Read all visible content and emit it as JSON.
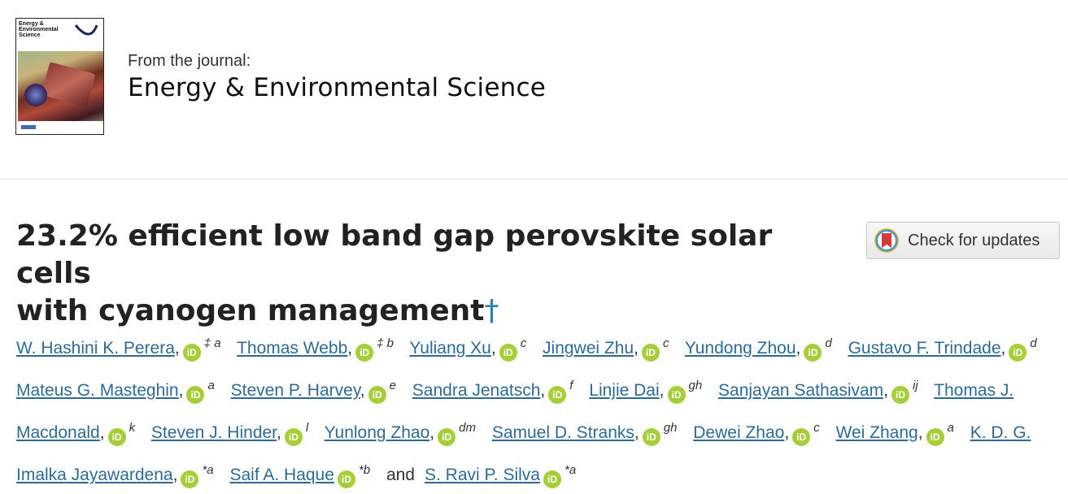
{
  "journal": {
    "from_label": "From the journal:",
    "name": "Energy & Environmental Science",
    "cover_title": "Energy & Environmental Science"
  },
  "article": {
    "title_line1": "23.2% efficient low band gap perovskite solar cells",
    "title_line2": "with cyanogen management",
    "title_dagger": "†",
    "check_updates_label": "Check for updates"
  },
  "authors": [
    {
      "name": "W. Hashini K. Perera",
      "sep": ",",
      "sup": "‡ a"
    },
    {
      "name": "Thomas Webb",
      "sep": ",",
      "sup": "‡ b"
    },
    {
      "name": "Yuliang Xu",
      "sep": ",",
      "sup": "c"
    },
    {
      "name": "Jingwei Zhu",
      "sep": ",",
      "sup": "c"
    },
    {
      "name": "Yundong Zhou",
      "sep": ",",
      "sup": "d"
    },
    {
      "name": "Gustavo F. Trindade",
      "sep": ",",
      "sup": "d"
    },
    {
      "name": "Mateus G. Masteghin",
      "sep": ",",
      "sup": "a"
    },
    {
      "name": "Steven P. Harvey",
      "sep": ",",
      "sup": "e"
    },
    {
      "name": "Sandra Jenatsch",
      "sep": ",",
      "sup": "f"
    },
    {
      "name": "Linjie Dai",
      "sep": ",",
      "sup": "gh"
    },
    {
      "name": "Sanjayan Sathasivam",
      "sep": ",",
      "sup": "ij"
    },
    {
      "name": "Thomas J. Macdonald",
      "sep": ",",
      "sup": "k"
    },
    {
      "name": "Steven J. Hinder",
      "sep": ",",
      "sup": "l"
    },
    {
      "name": "Yunlong Zhao",
      "sep": ",",
      "sup": "dm"
    },
    {
      "name": "Samuel D. Stranks",
      "sep": ",",
      "sup": "gh"
    },
    {
      "name": "Dewei Zhao",
      "sep": ",",
      "sup": "c"
    },
    {
      "name": "Wei Zhang",
      "sep": ",",
      "sup": "a"
    },
    {
      "name": "K. D. G. Imalka Jayawardena",
      "sep": ",",
      "sup": "*a"
    },
    {
      "name": "Saif A. Haque",
      "sep": "",
      "sup": "*b"
    },
    {
      "name": "S. Ravi P. Silva",
      "sep": "",
      "sup": "*a"
    }
  ],
  "orcid_label": "iD",
  "and_word": "and",
  "icons": {
    "orcid": "orcid-icon",
    "updates": "crossmark-icon"
  },
  "colors": {
    "link": "#2f6a97",
    "orcid": "#a6ce39",
    "dagger": "#2d7fb9"
  }
}
